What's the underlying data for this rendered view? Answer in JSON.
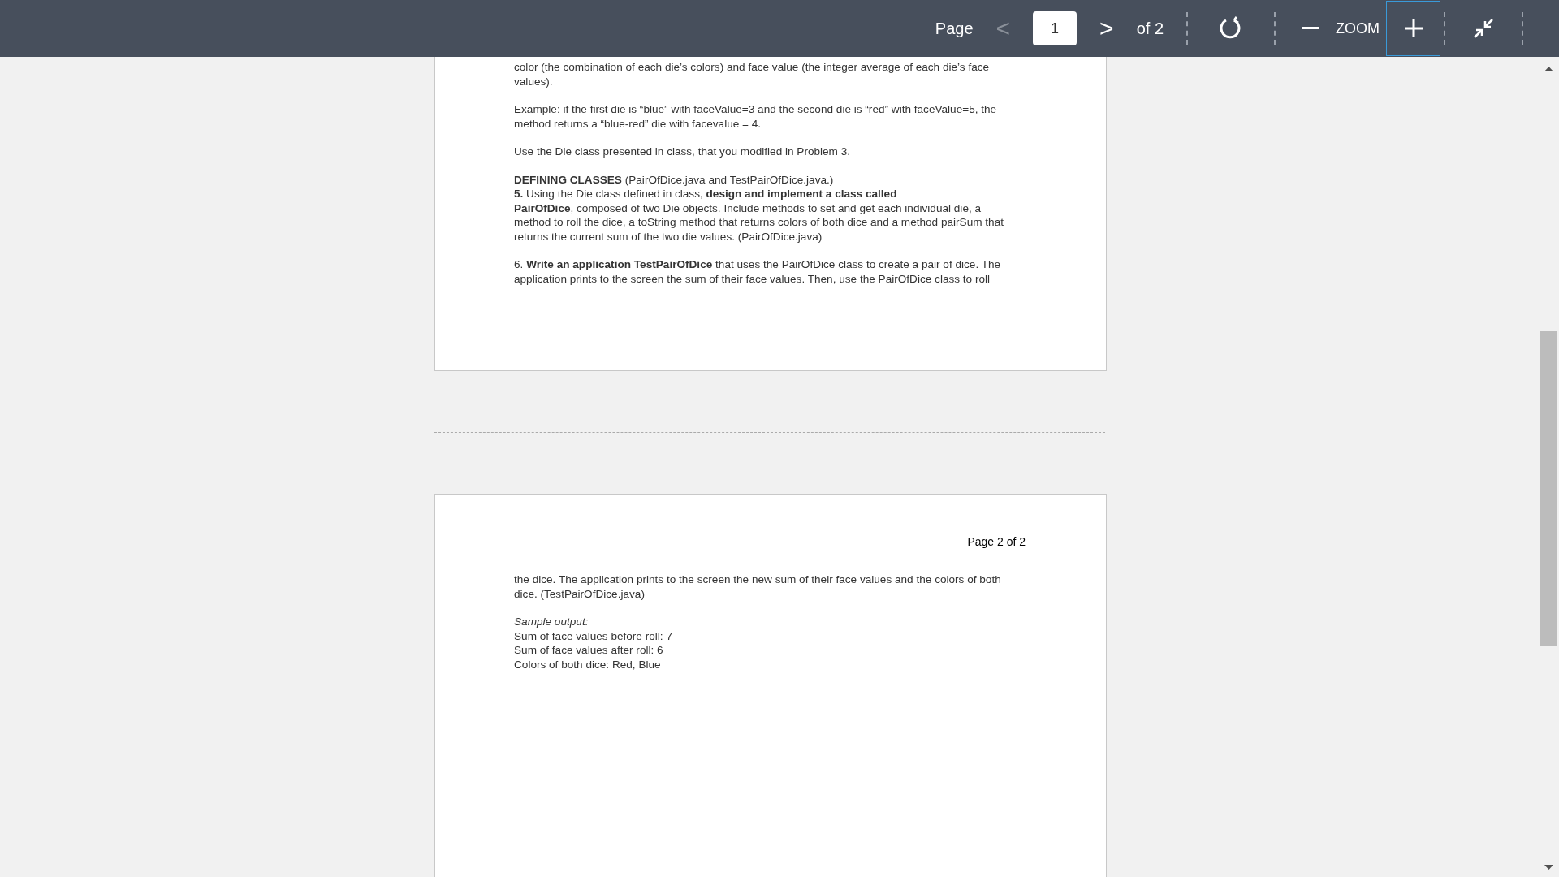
{
  "toolbar": {
    "page_label": "Page",
    "prev": {
      "text": "<",
      "disabled": true
    },
    "page_input": {
      "value": "1"
    },
    "next": {
      "text": ">",
      "disabled": false
    },
    "page_count": "of 2",
    "zoom_label": "ZOOM",
    "zoom_in": {
      "selected": true
    }
  },
  "pages": [
    {
      "paragraphs": [
        {
          "kind": "normal",
          "lines": [
            "color (the combination of each die’s colors) and face value (the integer average of each die’s face",
            "values)."
          ]
        },
        {
          "kind": "normal",
          "lines": [
            "Example: if the first die is “blue” with faceValue=3 and the second die is “red” with faceValue=5, the",
            "method returns a “blue-red” die with facevalue = 4."
          ]
        },
        {
          "kind": "normal",
          "lines": [
            "Use the Die class presented in class, that you modified in Problem 3."
          ]
        },
        {
          "kind": "normal",
          "lines": [
            "**DEFINING CLASSES** (PairOfDice.java and TestPairOfDice.java.)",
            "**5.** Using the Die class defined in class, **design and implement a class called**",
            "**PairOfDice**, composed of two Die objects. Include methods to set and get each individual die, a",
            "method to roll the dice, a toString method that returns colors of both dice and a method pairSum that",
            "returns the current sum of the two die values. (PairOfDice.java)"
          ]
        },
        {
          "kind": "normal",
          "lines": [
            "6. **Write an application TestPairOfDice** that uses the PairOfDice class to create a pair of dice. The",
            "application prints to the screen the sum of their face values. Then, use the PairOfDice class to roll"
          ]
        }
      ]
    },
    {
      "header": "Page 2 of 2",
      "paragraphs": [
        {
          "kind": "normal",
          "lines": [
            "the dice. The application prints to the screen the new sum of their face values and the colors of both",
            "dice. (TestPairOfDice.java)"
          ]
        },
        {
          "kind": "caption",
          "lines": [
            "Sample output:"
          ]
        },
        {
          "kind": "output",
          "lines": [
            "Sum of face values before roll: 7"
          ]
        },
        {
          "kind": "output",
          "lines": [
            "Sum of face values after roll: 6"
          ]
        },
        {
          "kind": "output",
          "lines": [
            "Colors of both dice: Red, Blue"
          ]
        }
      ]
    }
  ]
}
